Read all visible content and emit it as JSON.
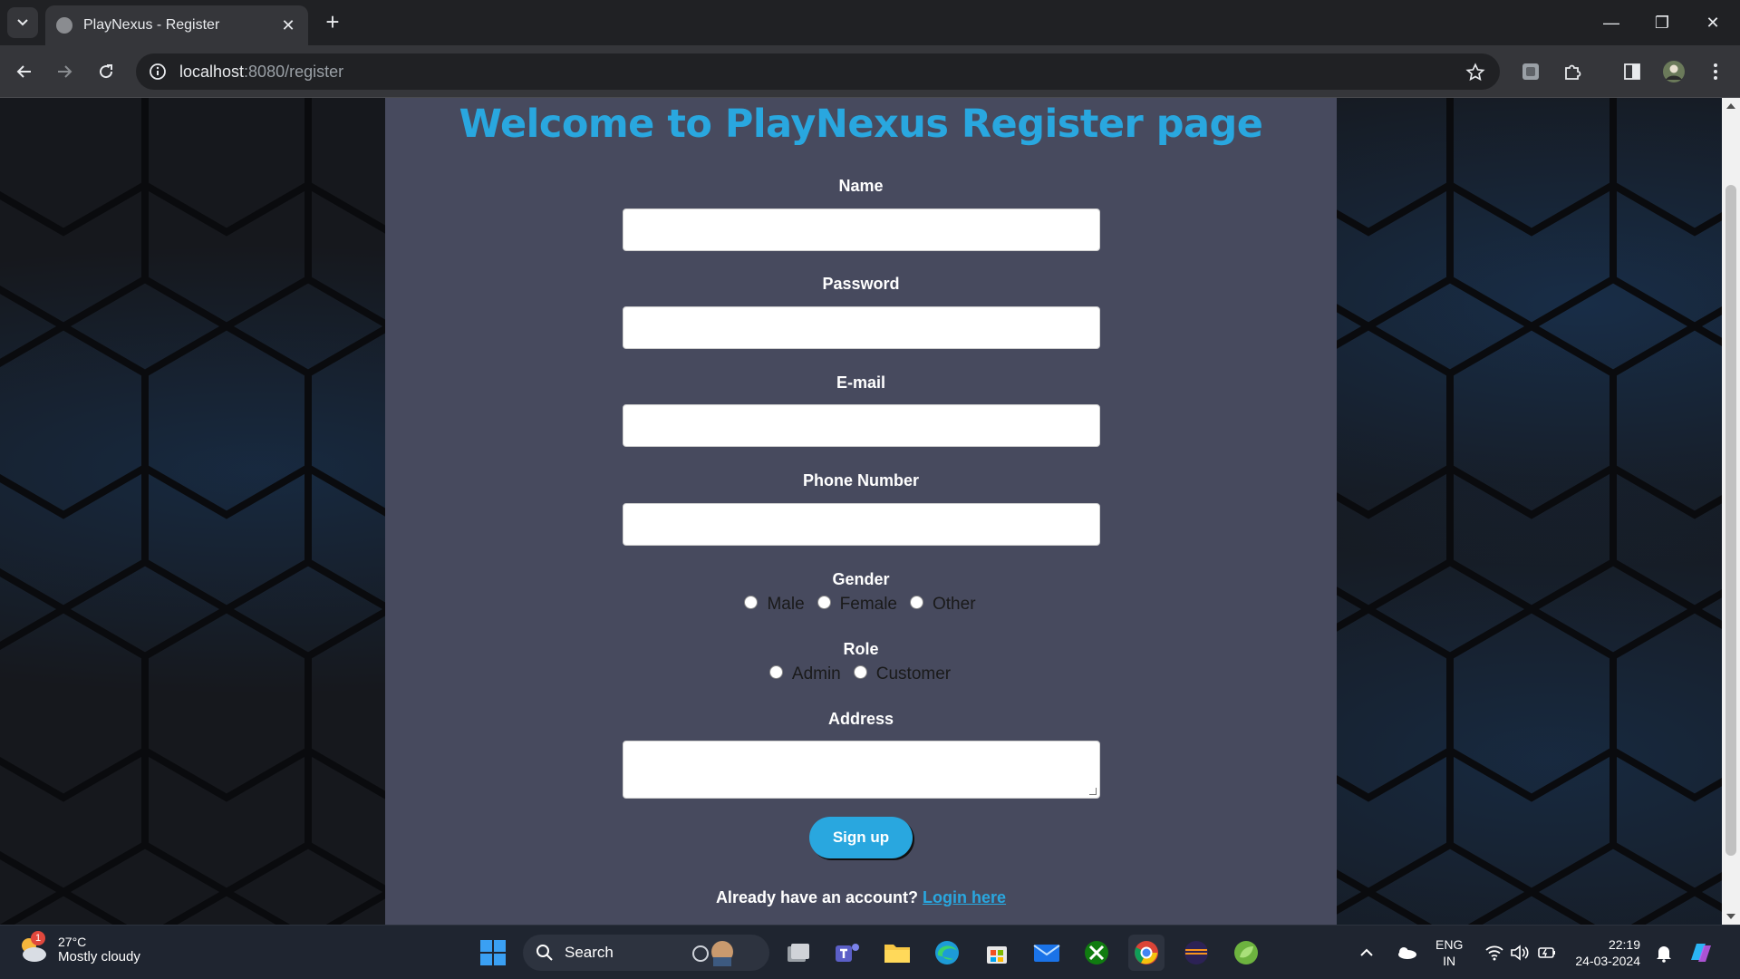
{
  "browser": {
    "tab_title": "PlayNexus - Register",
    "url_host": "localhost",
    "url_path": ":8080/register"
  },
  "page": {
    "title": "Welcome to PlayNexus Register page",
    "fields": {
      "name_label": "Name",
      "password_label": "Password",
      "email_label": "E-mail",
      "phone_label": "Phone Number",
      "gender_label": "Gender",
      "role_label": "Role",
      "address_label": "Address"
    },
    "gender_options": [
      "Male",
      "Female",
      "Other"
    ],
    "role_options": [
      "Admin",
      "Customer"
    ],
    "signup_label": "Sign up",
    "login_prompt": "Already have an account?",
    "login_link": "Login here",
    "colors": {
      "accent": "#29a7df",
      "panel": "#474a5e"
    }
  },
  "taskbar": {
    "weather_badge": "1",
    "temperature": "27°C",
    "condition": "Mostly cloudy",
    "search_label": "Search",
    "lang_top": "ENG",
    "lang_bottom": "IN",
    "time": "22:19",
    "date": "24-03-2024"
  }
}
